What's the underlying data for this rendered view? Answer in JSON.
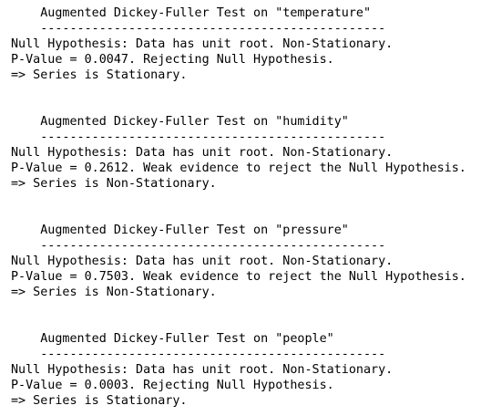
{
  "output": {
    "blocks": [
      {
        "title": "    Augmented Dickey-Fuller Test on \"temperature\"",
        "separator": "    -----------------------------------------------",
        "null_hypothesis": "Null Hypothesis: Data has unit root. Non-Stationary.",
        "p_value_line": "P-Value = 0.0047. Rejecting Null Hypothesis.",
        "conclusion": "=> Series is Stationary."
      },
      {
        "title": "    Augmented Dickey-Fuller Test on \"humidity\"",
        "separator": "    -----------------------------------------------",
        "null_hypothesis": "Null Hypothesis: Data has unit root. Non-Stationary.",
        "p_value_line": "P-Value = 0.2612. Weak evidence to reject the Null Hypothesis.",
        "conclusion": "=> Series is Non-Stationary."
      },
      {
        "title": "    Augmented Dickey-Fuller Test on \"pressure\"",
        "separator": "    -----------------------------------------------",
        "null_hypothesis": "Null Hypothesis: Data has unit root. Non-Stationary.",
        "p_value_line": "P-Value = 0.7503. Weak evidence to reject the Null Hypothesis.",
        "conclusion": "=> Series is Non-Stationary."
      },
      {
        "title": "    Augmented Dickey-Fuller Test on \"people\"",
        "separator": "    -----------------------------------------------",
        "null_hypothesis": "Null Hypothesis: Data has unit root. Non-Stationary.",
        "p_value_line": "P-Value = 0.0003. Rejecting Null Hypothesis.",
        "conclusion": "=> Series is Stationary."
      }
    ]
  }
}
